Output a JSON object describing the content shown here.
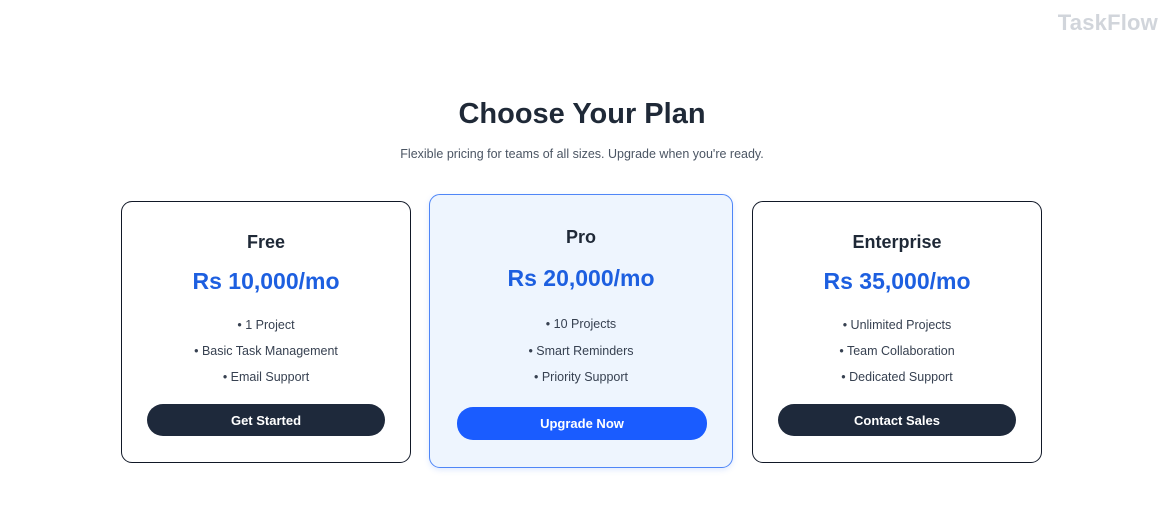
{
  "brand": "TaskFlow",
  "heading": "Choose Your Plan",
  "subheading": "Flexible pricing for teams of all sizes. Upgrade when you're ready.",
  "plans": [
    {
      "name": "Free",
      "price": "Rs 10,000/mo",
      "features": [
        "• 1 Project",
        "• Basic Task Management",
        "• Email Support"
      ],
      "cta": "Get Started"
    },
    {
      "name": "Pro",
      "price": "Rs 20,000/mo",
      "features": [
        "• 10 Projects",
        "• Smart Reminders",
        "• Priority Support"
      ],
      "cta": "Upgrade Now"
    },
    {
      "name": "Enterprise",
      "price": "Rs 35,000/mo",
      "features": [
        "• Unlimited Projects",
        "• Team Collaboration",
        "• Dedicated Support"
      ],
      "cta": "Contact Sales"
    }
  ],
  "colors": {
    "accent": "#1a5cff",
    "price": "#1d5fe0",
    "dark_button": "#1e293b",
    "highlight_card_bg": "#eef5fe",
    "highlight_card_border": "#4f86f7"
  }
}
